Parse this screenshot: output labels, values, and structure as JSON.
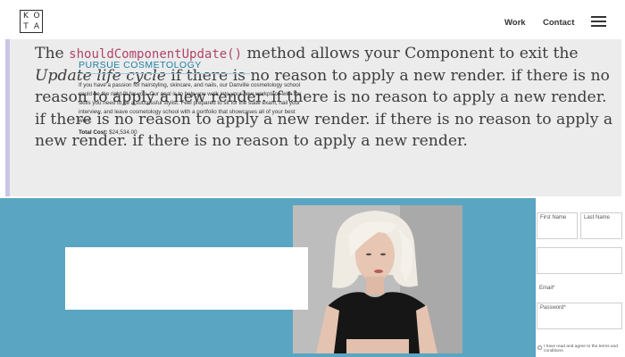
{
  "header": {
    "logo_letters": [
      "K",
      "O",
      "T",
      "A"
    ],
    "nav": {
      "work": "Work",
      "contact": "Contact"
    }
  },
  "quote": {
    "intro": "The ",
    "code": "shouldComponentUpdate()",
    "after_code": " method allows your Component to exit the ",
    "emphasis": "Update life cycle",
    "rest": " if there is no reason to apply a new render. if there is no reason to apply a new render. if there is no reason to apply a new render. if there is no reason to apply a new render. if there is no reason to apply a new render. if there is no reason to apply a new render."
  },
  "cosmetology": {
    "title": "PURSUE COSMETOLOGY",
    "body": "If you have a passion for hairstyling, skincare, and nails, our Danville cosmetology school could be the right fit for you. Our goal is to help you walk into your new workplace with the skills you need to be a successful stylist. Feel prepared to sit for the state exam, nail your interview, and leave cosmetology school with a portfolio that showcases all of your best work.",
    "cost_label": "Total Cost:",
    "cost_value": "$24,534.00"
  },
  "form": {
    "first_name": "First Name",
    "last_name": "Last Name",
    "email_label": "Email*",
    "password_value": "Password*",
    "checkbox_label": "I have read and agree to the terms and conditions"
  },
  "colors": {
    "section_bg": "#5aa5c2",
    "quote_bg": "#ececec",
    "quote_border": "#c9c6e6",
    "code_color": "#b0456a",
    "title_color": "#1c7fa6"
  }
}
